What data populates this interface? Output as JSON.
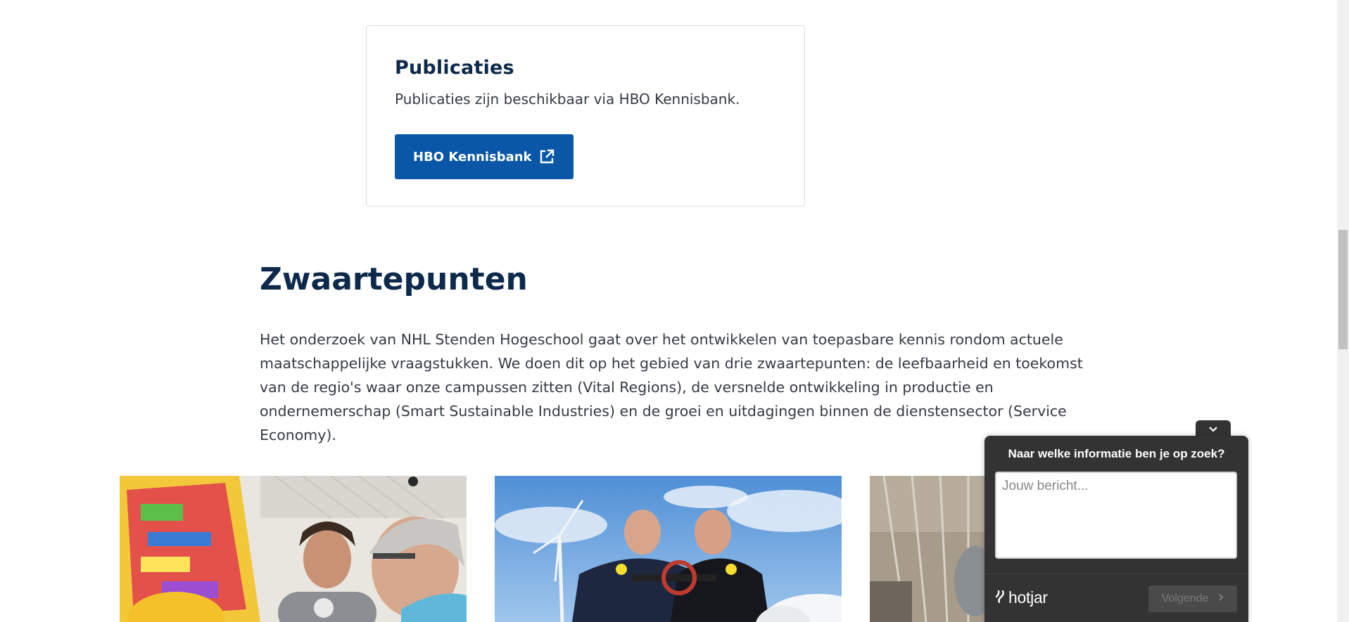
{
  "publicaties": {
    "title": "Publicaties",
    "description": "Publicaties zijn beschikbaar via HBO Kennisbank.",
    "button_label": "HBO Kennisbank",
    "button_icon": "external-link-icon"
  },
  "zwaartepunten": {
    "title": "Zwaartepunten",
    "body": "Het onderzoek van NHL Stenden Hogeschool gaat over het ontwikkelen van toepasbare kennis rondom actuele maatschappelijke vraagstukken. We doen dit op het gebied van drie zwaartepunten: de leefbaarheid en toekomst van de regio's waar onze campussen zitten (Vital Regions), de versnelde ontwikkeling in productie en ondernemerschap (Smart Sustainable Industries) en de groei en uitdagingen binnen de dienstensector (Service Economy)."
  },
  "hotjar": {
    "question": "Naar welke informatie ben je op zoek?",
    "placeholder": "Jouw bericht...",
    "brand": "hotjar",
    "next_label": "Volgende",
    "collapse_icon": "chevron-down-icon"
  },
  "colors": {
    "brand_blue": "#0a57a8",
    "heading_navy": "#0d2a4c",
    "widget_bg": "#333333"
  }
}
